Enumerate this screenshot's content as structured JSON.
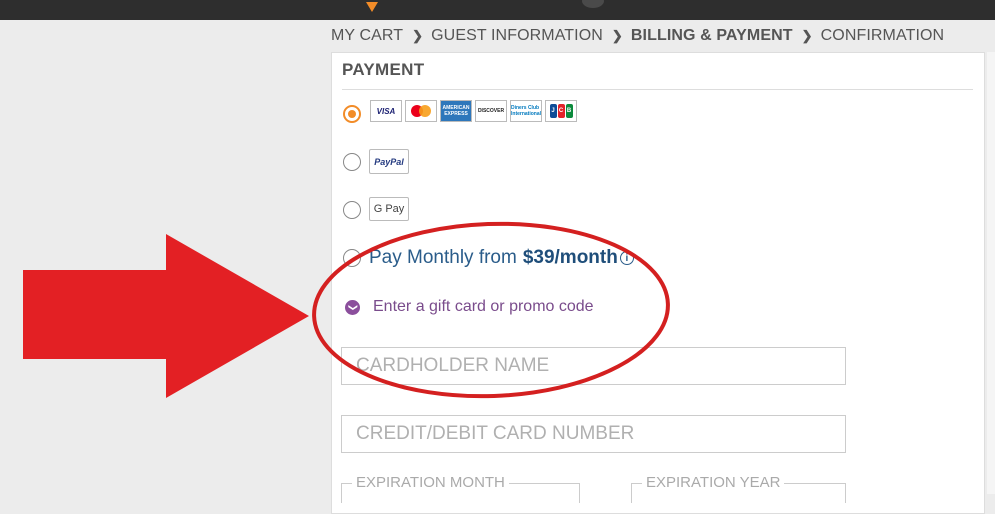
{
  "breadcrumb": {
    "step1": "MY CART",
    "step2": "GUEST INFORMATION",
    "step3": "BILLING & PAYMENT",
    "step4": "CONFIRMATION"
  },
  "payment": {
    "title": "PAYMENT",
    "cards": {
      "visa": "VISA",
      "amex": "AMERICAN EXPRESS",
      "discover": "DISCOVER",
      "diners": "Diners Club International",
      "jcb": [
        "J",
        "C",
        "B"
      ]
    },
    "paypal_label": "PayPal",
    "gpay_label": "G Pay",
    "monthly_text": "Pay Monthly from",
    "monthly_price": "$39/month",
    "info_glyph": "i",
    "promo_label": "Enter a gift card or promo code",
    "promo_glyph": "❯"
  },
  "form": {
    "cardholder_placeholder": "CARDHOLDER NAME",
    "card_number_placeholder": "CREDIT/DEBIT CARD NUMBER",
    "exp_month_label": "EXPIRATION MONTH",
    "exp_year_label": "EXPIRATION YEAR"
  },
  "colors": {
    "accent": "#f28c28",
    "promo": "#8b4f9c",
    "annotation": "#e32024",
    "link_blue": "#2a5c8a"
  },
  "icons": [
    "chevron-right-icon",
    "info-icon",
    "chevron-down-icon",
    "arrow-icon"
  ]
}
